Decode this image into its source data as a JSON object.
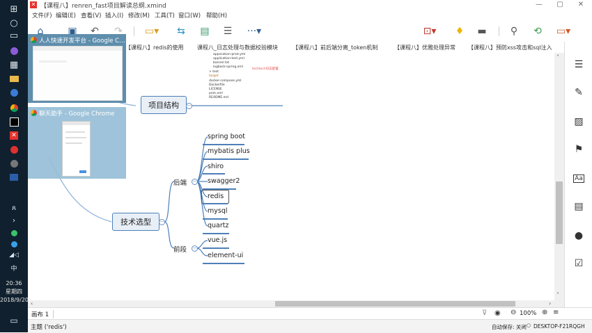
{
  "window": {
    "title": "【课程八】renren_fast项目解读总纲.xmind",
    "minimize": "—",
    "restore": "▢",
    "close": "✕"
  },
  "menu": [
    "文件(F)",
    "编辑(E)",
    "查看(V)",
    "插入(I)",
    "修改(M)",
    "工具(T)",
    "窗口(W)",
    "帮助(H)"
  ],
  "tabs": [
    "人人快速开发平台 - Google C…",
    "【课程八】redis的使用",
    "课程八_日志处理与数据校验模块",
    "【课程八】前后端分离_token机制",
    "【课程八】优雅处理异常",
    "【课程八】预防xss攻击和sql注入"
  ],
  "previews": [
    {
      "title": "人人快速开发平台 - Google C…"
    },
    {
      "title": "聊天助手 - Google Chrome"
    }
  ],
  "mindmap": {
    "project_structure": "项目结构",
    "tech_selection": "技术选型",
    "backend_label": "后端",
    "frontend_label": "前段",
    "backend_items": [
      "spring boot",
      "mybatis plus",
      "shiro",
      "swagger2",
      "redis",
      "mysql",
      "quartz"
    ],
    "frontend_items": [
      "vue.js",
      "element-ui"
    ],
    "file_tree": [
      "application-prod.yml",
      "application-test.yml",
      "banner.txt",
      "logback-spring.xml",
      "> test",
      "target",
      "docker-compose.yml",
      "Dockerfile",
      "LICENSE",
      "pom.xml",
      "README.md"
    ],
    "file_tree_note": "techtech日志配置"
  },
  "sheet": {
    "name": "画布 1"
  },
  "zoom": "100%",
  "status": {
    "topic": "主题 ('redis')",
    "autosave": "自动保存: 关闭",
    "computer": "DESKTOP-F21RQGH"
  },
  "clock": {
    "time": "20:36",
    "weekday": "星期四",
    "date": "2018/9/20"
  },
  "taskbar": {
    "ime": "中"
  }
}
